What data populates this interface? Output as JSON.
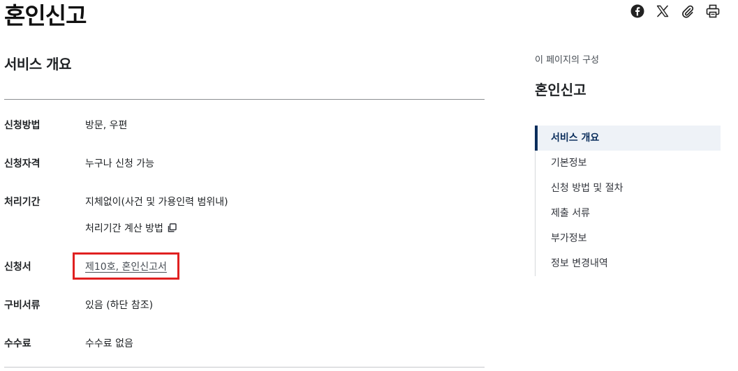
{
  "page": {
    "title": "혼인신고"
  },
  "share_tools": [
    {
      "icon": "facebook-icon"
    },
    {
      "icon": "x-icon"
    },
    {
      "icon": "paperclip-icon"
    },
    {
      "icon": "print-icon"
    }
  ],
  "overview": {
    "heading": "서비스 개요",
    "rows": [
      {
        "label": "신청방법",
        "value": "방문, 우편"
      },
      {
        "label": "신청자격",
        "value": "누구나 신청 가능"
      },
      {
        "label": "처리기간",
        "value": "지체없이(사건 및 가용인력 범위내)",
        "sub_link": "처리기간 계산 방법"
      },
      {
        "label": "신청서",
        "link": "제10호, 혼인신고서"
      },
      {
        "label": "구비서류",
        "value": "있음 (하단 참조)"
      },
      {
        "label": "수수료",
        "value": "수수료 없음"
      }
    ]
  },
  "toc": {
    "caption": "이 페이지의 구성",
    "title": "혼인신고",
    "items": [
      {
        "label": "서비스 개요",
        "active": true
      },
      {
        "label": "기본정보"
      },
      {
        "label": "신청 방법 및 절차"
      },
      {
        "label": "제출 서류"
      },
      {
        "label": "부가정보"
      },
      {
        "label": "정보 변경내역"
      }
    ]
  },
  "colors": {
    "accent": "#0b2e5c",
    "highlight_box": "#e02020",
    "active_bg": "#eef2f7"
  }
}
